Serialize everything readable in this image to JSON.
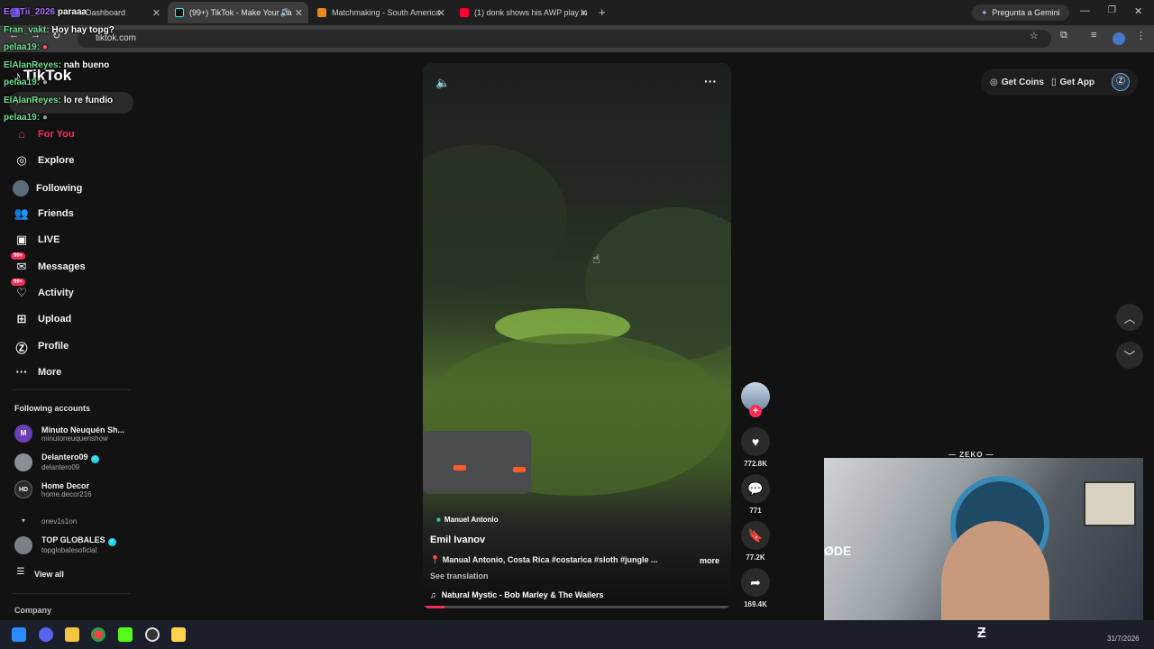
{
  "browser": {
    "tabs": [
      {
        "title": "k Dashboard",
        "active": false
      },
      {
        "title": "(99+) TikTok - Make Your Da",
        "active": true
      },
      {
        "title": "Matchmaking - South America",
        "active": false
      },
      {
        "title": "(1) donk shows his AWP play in",
        "active": false
      }
    ],
    "url": "tiktok.com",
    "gemini_label": "Pregunta a Gemini"
  },
  "chat": [
    {
      "user": "Es_Tii_2026",
      "msg": "paraaa"
    },
    {
      "user": "Fran_vakt:",
      "msg": "Hoy hay topg?"
    },
    {
      "user": "pelaa19:",
      "msg": ""
    },
    {
      "user": "ElAlanReyes:",
      "msg": "nah bueno"
    },
    {
      "user": "pelaa19:",
      "msg": ""
    },
    {
      "user": "ElAlanReyes:",
      "msg": "lo re fundio"
    },
    {
      "user": "pelaa19:",
      "msg": ""
    }
  ],
  "brand": {
    "logo": "TikTok"
  },
  "nav": [
    {
      "label": "For You",
      "icon": "home-icon"
    },
    {
      "label": "Explore",
      "icon": "compass-icon"
    },
    {
      "label": "Following",
      "icon": "following-icon"
    },
    {
      "label": "Friends",
      "icon": "friends-icon"
    },
    {
      "label": "LIVE",
      "icon": "live-icon"
    },
    {
      "label": "Messages",
      "icon": "messages-icon",
      "badge": "99+"
    },
    {
      "label": "Activity",
      "icon": "activity-icon",
      "badge": "99+"
    },
    {
      "label": "Upload",
      "icon": "upload-icon"
    },
    {
      "label": "Profile",
      "icon": "profile-icon"
    },
    {
      "label": "More",
      "icon": "more-icon"
    }
  ],
  "following": {
    "heading": "Following accounts",
    "accounts": [
      {
        "name": "Minuto Neuquén Sh...",
        "handle": "minutoneuquenshow",
        "avatar": "M"
      },
      {
        "name": "Delantero09",
        "handle": "delantero09",
        "avatar": "",
        "verified": true
      },
      {
        "name": "Home Decor",
        "handle": "home.decor216",
        "avatar": "HD"
      },
      {
        "name": "",
        "handle": "onev1s1on",
        "avatar": ""
      },
      {
        "name": "TOP GLOBALES",
        "handle": "topglobalesoficial",
        "avatar": "",
        "verified": true
      }
    ],
    "view_all": "View all"
  },
  "company_label": "Company",
  "topbar": {
    "get_coins": "Get Coins",
    "get_app": "Get App"
  },
  "video": {
    "location": "Manuel Antonio",
    "author": "Emil Ivanov",
    "caption": "Manual Antonio, Costa Rica #costarica #sloth #jungle ...",
    "more": "more",
    "see_translation": "See translation",
    "music": "Natural Mystic - Bob Marley & The Wailers",
    "progress": 0.07
  },
  "actions": {
    "likes": "772.8K",
    "comments": "771",
    "saves": "77.2K",
    "shares": "169.4K"
  },
  "overlay": {
    "cam_label": "ZEKO",
    "cam_text": "ØDE"
  },
  "taskbar": {
    "date": "31/7/2026"
  }
}
